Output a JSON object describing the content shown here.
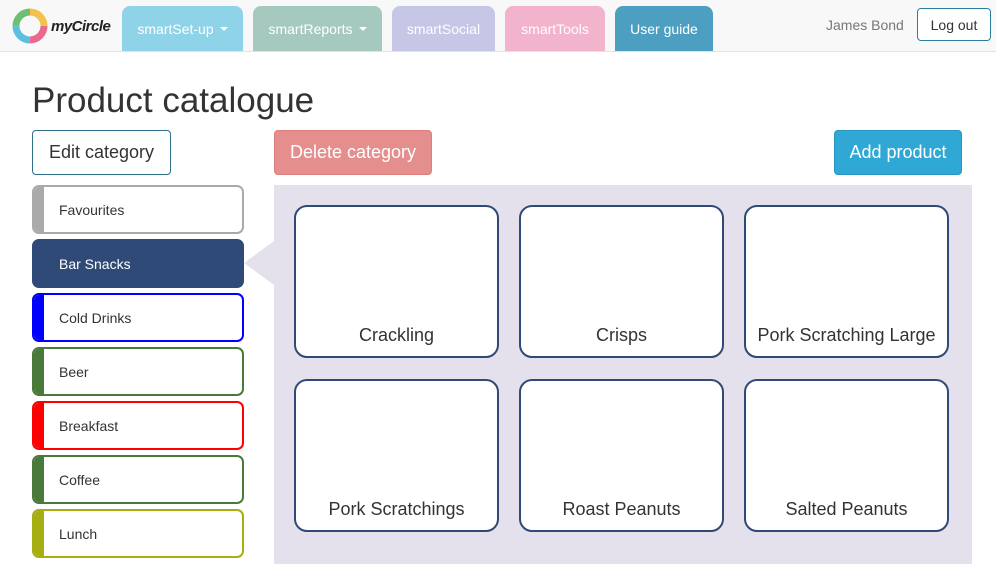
{
  "brand": {
    "name": "myCircle"
  },
  "nav": {
    "tabs": [
      {
        "label": "smartSet-up",
        "color": "#8fd3e8",
        "dropdown": true
      },
      {
        "label": "smartReports",
        "color": "#a6c9bf",
        "dropdown": true
      },
      {
        "label": "smartSocial",
        "color": "#c6c6e6",
        "dropdown": false
      },
      {
        "label": "smartTools",
        "color": "#f2b3cd",
        "dropdown": false
      },
      {
        "label": "User guide",
        "color": "#4d9fc1",
        "dropdown": false
      }
    ],
    "user": "James Bond",
    "logout": "Log out"
  },
  "page": {
    "title": "Product catalogue",
    "edit_label": "Edit category",
    "delete_label": "Delete category",
    "add_label": "Add product"
  },
  "categories": [
    {
      "label": "Favourites",
      "color": "#aaaaaa"
    },
    {
      "label": "Bar Snacks",
      "color": "#2f4a76",
      "active": true
    },
    {
      "label": "Cold Drinks",
      "color": "#0000ff"
    },
    {
      "label": "Beer",
      "color": "#4a7a3a"
    },
    {
      "label": "Breakfast",
      "color": "#ff0000"
    },
    {
      "label": "Coffee",
      "color": "#4a7a3a"
    },
    {
      "label": "Lunch",
      "color": "#a6ae12"
    }
  ],
  "products": [
    "Crackling",
    "Crisps",
    "Pork Scratching Large",
    "Pork Scratchings",
    "Roast Peanuts",
    "Salted Peanuts"
  ]
}
